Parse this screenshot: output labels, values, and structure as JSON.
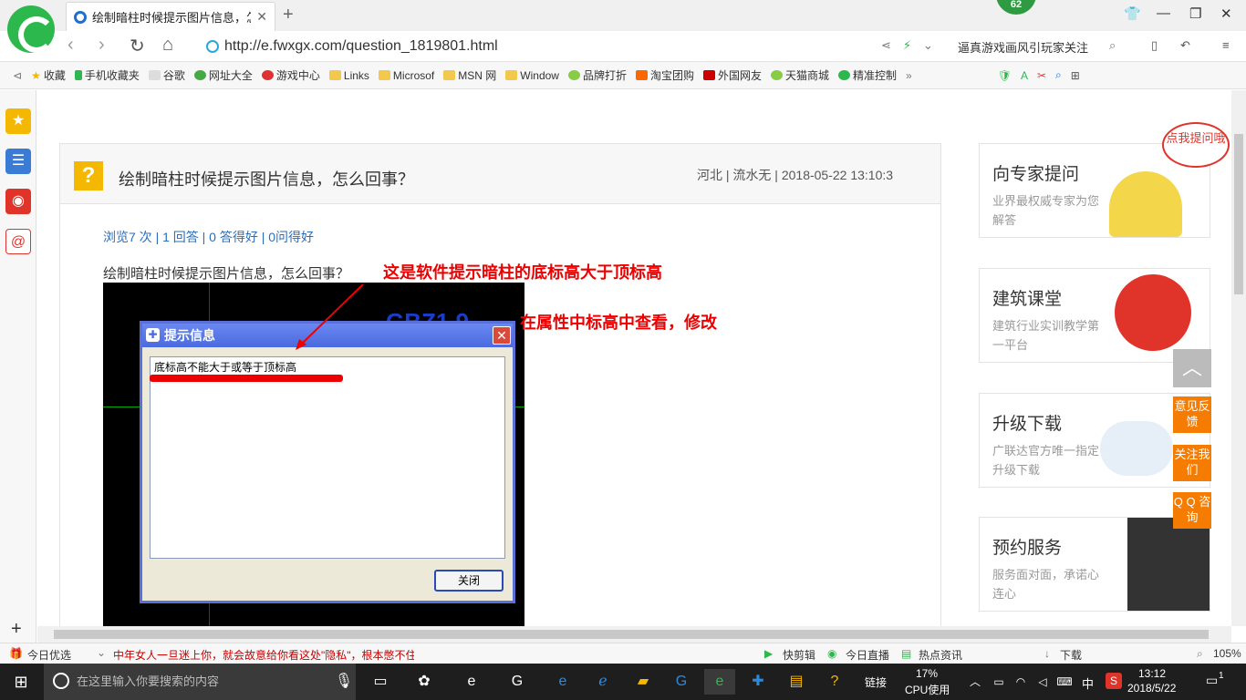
{
  "browser": {
    "tab_title": "绘制暗柱时候提示图片信息，怎么",
    "badge": "62",
    "url": "http://e.fwxgx.com/question_1819801.html",
    "news_ticker": "逼真游戏画风引玩家关注"
  },
  "bookmarks": [
    "收藏",
    "手机收藏夹",
    "谷歌",
    "网址大全",
    "游戏中心",
    "Links",
    "Microsof",
    "MSN 网",
    "Window",
    "品牌打折",
    "淘宝团购",
    "外国网友",
    "天猫商城",
    "精准控制"
  ],
  "question": {
    "title": "绘制暗柱时候提示图片信息，怎么回事？",
    "meta": "河北 | 流水无 | 2018-05-22 13:10:3",
    "stats": "浏览7 次 | 1 回答 | 0 答得好 | 0问得好",
    "body": "绘制暗柱时候提示图片信息，怎么回事？",
    "note1": "这是软件提示暗柱的底标高大于顶标高",
    "note2": "在属性中标高中查看，修改"
  },
  "dialog": {
    "title": "提示信息",
    "message": "底标高不能大于或等于顶标高",
    "close": "关闭",
    "cad_text": "GBZ1  9"
  },
  "sidebar_cards": [
    {
      "title": "向专家提问",
      "desc": "业界最权威专家为您解答",
      "bubble": "点我提问哦"
    },
    {
      "title": "建筑课堂",
      "desc": "建筑行业实训教学第一平台"
    },
    {
      "title": "升级下载",
      "desc": "广联达官方唯一指定升级下载"
    },
    {
      "title": "预约服务",
      "desc": "服务面对面，承诺心连心"
    }
  ],
  "float_buttons": [
    "意见反馈",
    "关注我们",
    "Q Q 咨询"
  ],
  "statusbar": {
    "left": "今日优选",
    "ticker": "中年女人一旦迷上你，就会故意给你看这处\"隐私\"，根本憋不住!",
    "items": [
      "快剪辑",
      "今日直播",
      "热点资讯",
      "下载"
    ],
    "zoom": "105%"
  },
  "taskbar": {
    "search": "在这里输入你要搜索的内容",
    "link": "链接",
    "cpu": "17%",
    "cpu_label": "CPU使用",
    "ime": "中",
    "time": "13:12",
    "date": "2018/5/22",
    "notif": "1"
  }
}
